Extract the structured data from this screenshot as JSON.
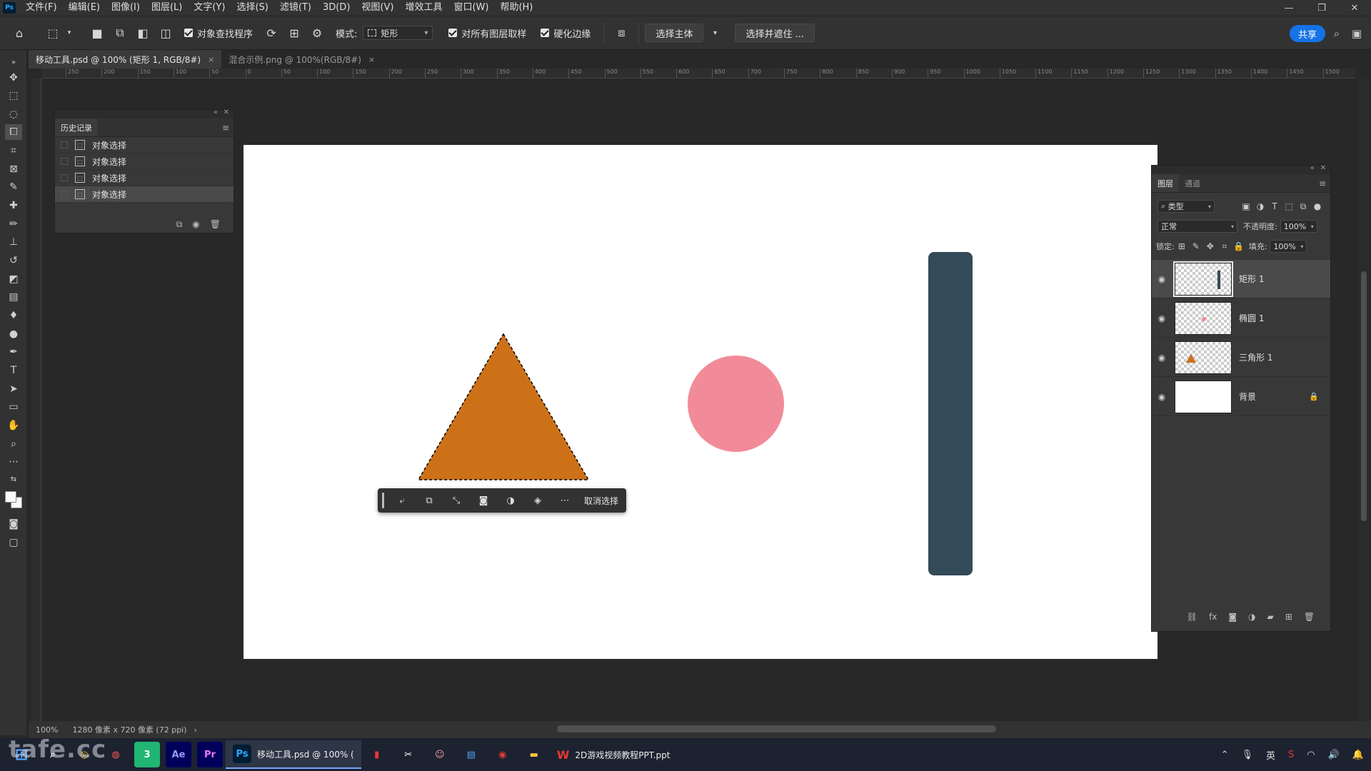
{
  "menubar": {
    "logo": "Ps",
    "items": [
      "文件(F)",
      "编辑(E)",
      "图像(I)",
      "图层(L)",
      "文字(Y)",
      "选择(S)",
      "滤镜(T)",
      "3D(D)",
      "视图(V)",
      "增效工具",
      "窗口(W)",
      "帮助(H)"
    ],
    "win": {
      "min": "—",
      "restore": "❐",
      "close": "✕"
    }
  },
  "options": {
    "auto_select_label": "对象查找程序",
    "mode_label": "模式:",
    "mode_value": "矩形",
    "sample_all_label": "对所有图层取样",
    "harden_edge_label": "硬化边缘",
    "select_subject": "选择主体",
    "select_mask": "选择并遮住 ...",
    "share": "共享"
  },
  "tabs": [
    {
      "label": "移动工具.psd @ 100% (矩形 1, RGB/8#)",
      "close": "×"
    },
    {
      "label": "混合示例.png @ 100%(RGB/8#)",
      "close": "×"
    }
  ],
  "ruler": {
    "ticks": [
      "250",
      "200",
      "150",
      "100",
      "50",
      "0",
      "50",
      "100",
      "150",
      "200",
      "250",
      "300",
      "350",
      "400",
      "450",
      "500",
      "550",
      "600",
      "650",
      "700",
      "750",
      "800",
      "850",
      "900",
      "950",
      "1000",
      "1050",
      "1100",
      "1150",
      "1200",
      "1250",
      "1300",
      "1350",
      "1400",
      "1450",
      "1500"
    ]
  },
  "history": {
    "title": "历史记录",
    "items": [
      "对象选择",
      "对象选择",
      "对象选择",
      "对象选择"
    ]
  },
  "context_bar": {
    "deselect": "取消选择"
  },
  "layers": {
    "tab_layers": "图层",
    "tab_channels": "通道",
    "filter_kind": "类型",
    "blend_mode": "正常",
    "opacity_label": "不透明度:",
    "opacity_value": "100%",
    "lock_label": "锁定:",
    "fill_label": "填充:",
    "fill_value": "100%",
    "items": [
      {
        "name": "矩形 1",
        "selected": true
      },
      {
        "name": "椭圆 1",
        "selected": false
      },
      {
        "name": "三角形 1",
        "selected": false
      },
      {
        "name": "背景",
        "selected": false,
        "locked": true
      }
    ]
  },
  "shapes": {
    "triangle_color": "#cd7118",
    "circle_color": "#f28b99",
    "rect_color": "#334a58"
  },
  "status": {
    "zoom": "100%",
    "doc_info": "1280 像素 x 720 像素 (72 ppi)"
  },
  "taskbar": {
    "ps_app": "移动工具.psd @ 100% (",
    "wps_app": "2D游戏视频教程PPT.ppt",
    "ime": "英",
    "watermark": "tafe.cc"
  }
}
